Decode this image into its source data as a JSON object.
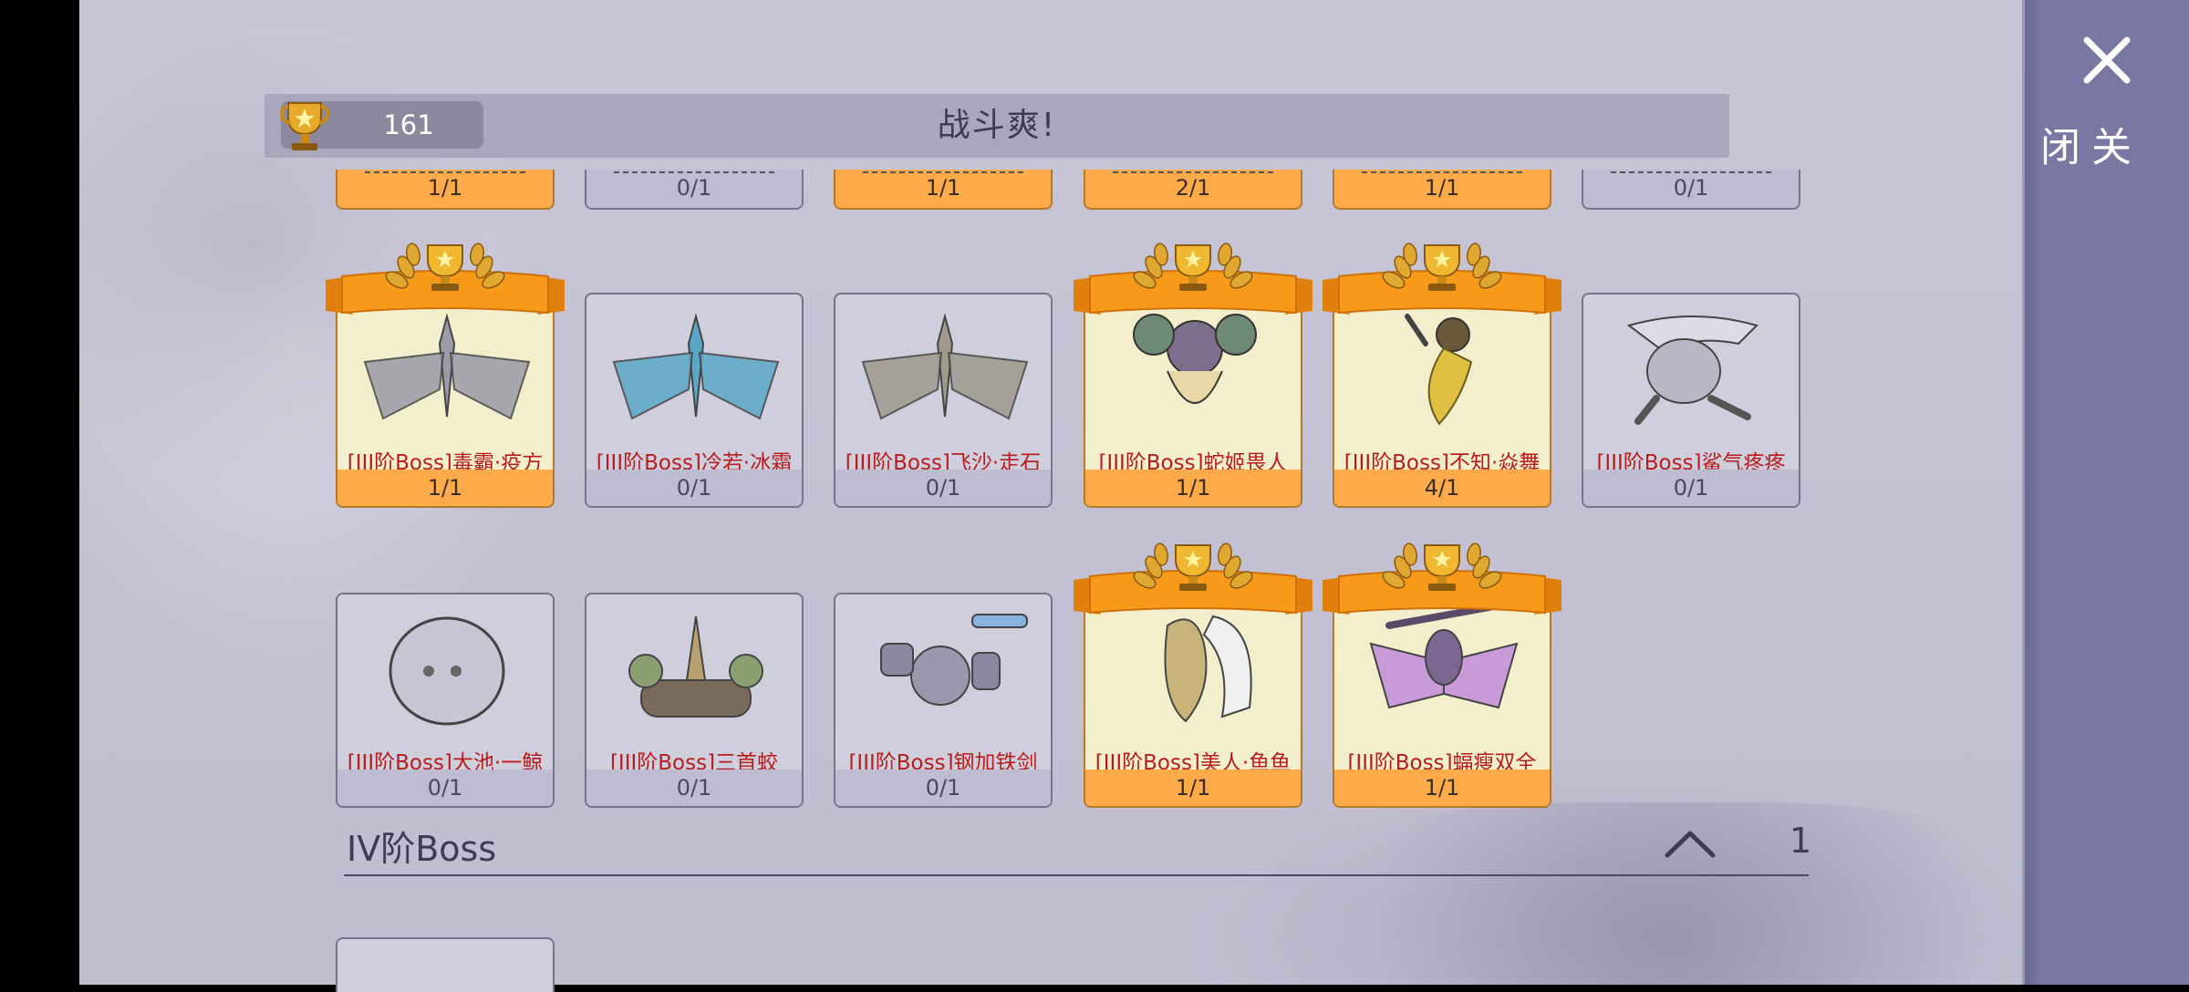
{
  "header": {
    "score": "161",
    "title": "战斗爽!"
  },
  "top_partial_counts": [
    {
      "count": "1/1",
      "done": true
    },
    {
      "count": "0/1",
      "done": false
    },
    {
      "count": "1/1",
      "done": true
    },
    {
      "count": "2/1",
      "done": true
    },
    {
      "count": "1/1",
      "done": true
    },
    {
      "count": "0/1",
      "done": false
    }
  ],
  "bosses": [
    {
      "name": "[III阶Boss]毒霸·疫方",
      "count": "1/1",
      "done": true,
      "art": "winged-dragon",
      "color": "#9c9aa8"
    },
    {
      "name": "[III阶Boss]冷若·冰霜",
      "count": "0/1",
      "done": false,
      "art": "winged-dragon",
      "color": "#5aa8c8"
    },
    {
      "name": "[III阶Boss]飞沙·走石",
      "count": "0/1",
      "done": false,
      "art": "winged-dragon",
      "color": "#a09a8c"
    },
    {
      "name": "[III阶Boss]蛇姬畏人",
      "count": "1/1",
      "done": true,
      "art": "mech-creature",
      "color": "#6f8a74"
    },
    {
      "name": "[III阶Boss]不知·焱舞",
      "count": "4/1",
      "done": true,
      "art": "fire-dancer",
      "color": "#e0c040"
    },
    {
      "name": "[III阶Boss]鲨气疼疼",
      "count": "0/1",
      "done": false,
      "art": "shark",
      "color": "#b9b7c6"
    },
    {
      "name": "[III阶Boss]大池·一鲸",
      "count": "0/1",
      "done": false,
      "art": "whale-egg",
      "color": "#c8c6d4"
    },
    {
      "name": "[III阶Boss]三首蛟",
      "count": "0/1",
      "done": false,
      "art": "three-headed",
      "color": "#b8a070"
    },
    {
      "name": "[III阶Boss]钢加铁剑",
      "count": "0/1",
      "done": false,
      "art": "robot-sword",
      "color": "#9a98ac"
    },
    {
      "name": "[III阶Boss]美人·鱼鱼",
      "count": "1/1",
      "done": true,
      "art": "mermaid",
      "color": "#c8b47a"
    },
    {
      "name": "[III阶Boss]蝠瘦双全",
      "count": "1/1",
      "done": true,
      "art": "bat",
      "color": "#c89ad8"
    }
  ],
  "section": {
    "title": "IV阶Boss",
    "count": "1"
  },
  "close": {
    "label": "关闭"
  },
  "colors": {
    "accent_orange": "#fdab4a",
    "banner_orange": "#f79a1a",
    "name_red": "#b81c1c",
    "panel_purple": "#7a77a3"
  }
}
